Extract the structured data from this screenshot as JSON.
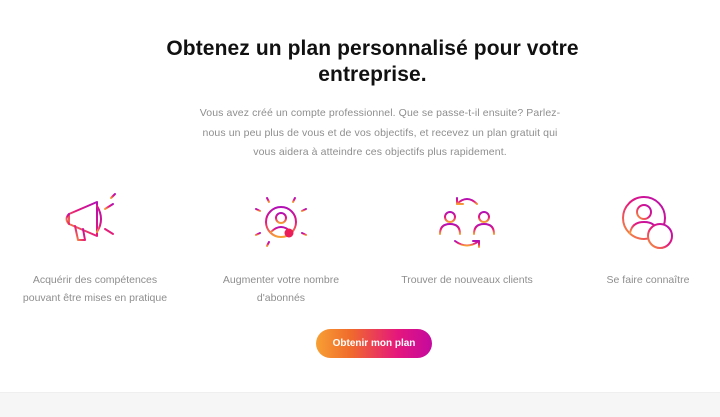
{
  "headline": {
    "line1": "Obtenez un plan personnalisé pour votre",
    "line2": "entreprise."
  },
  "intro": {
    "line1": "Vous avez créé un compte professionnel. Que se passe-t-il ensuite? Parlez-",
    "line2": "nous un peu plus de vous et de vos objectifs, et recevez un plan gratuit qui",
    "line3": "vous aidera à atteindre ces objectifs plus rapidement."
  },
  "features": [
    {
      "icon": "megaphone-icon",
      "line1": "Acquérir des compétences",
      "line2": "pouvant être mises en pratique"
    },
    {
      "icon": "audience-growth-icon",
      "line1": "Augmenter votre nombre",
      "line2": "d'abonnés"
    },
    {
      "icon": "new-clients-icon",
      "line1": "Trouver de nouveaux clients",
      "line2": ""
    },
    {
      "icon": "add-user-icon",
      "line1": "Se faire connaître",
      "line2": ""
    }
  ],
  "cta": {
    "label": "Obtenir mon plan"
  },
  "colors": {
    "gradient_start": "#f7a034",
    "gradient_mid": "#e5177c",
    "gradient_end": "#b10fb5",
    "body_text": "#8e8e8e",
    "headline": "#111111"
  }
}
